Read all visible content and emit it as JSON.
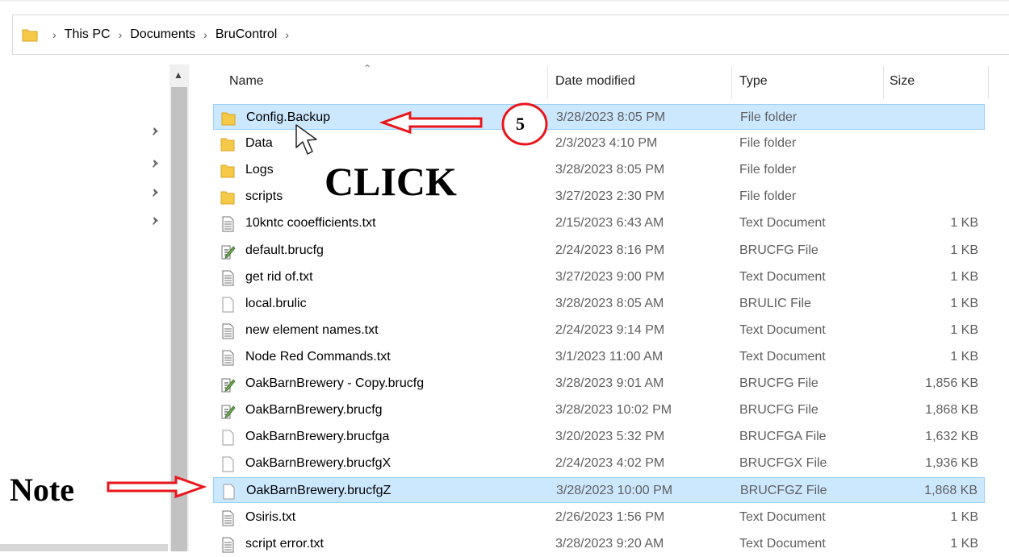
{
  "breadcrumb": [
    "This PC",
    "Documents",
    "BruControl"
  ],
  "columns": {
    "name": "Name",
    "date": "Date modified",
    "type": "Type",
    "size": "Size"
  },
  "files": [
    {
      "name": "Config.Backup",
      "date": "3/28/2023 8:05 PM",
      "type": "File folder",
      "size": "",
      "icon": "folder-icon"
    },
    {
      "name": "Data",
      "date": "2/3/2023 4:10 PM",
      "type": "File folder",
      "size": "",
      "icon": "folder-icon"
    },
    {
      "name": "Logs",
      "date": "3/28/2023 8:05 PM",
      "type": "File folder",
      "size": "",
      "icon": "folder-icon"
    },
    {
      "name": "scripts",
      "date": "3/27/2023 2:30 PM",
      "type": "File folder",
      "size": "",
      "icon": "folder-icon"
    },
    {
      "name": "10kntc cooefficients.txt",
      "date": "2/15/2023 6:43 AM",
      "type": "Text Document",
      "size": "1 KB",
      "icon": "text-file-icon"
    },
    {
      "name": "default.brucfg",
      "date": "2/24/2023 8:16 PM",
      "type": "BRUCFG File",
      "size": "1 KB",
      "icon": "config-file-icon"
    },
    {
      "name": "get rid of.txt",
      "date": "3/27/2023 9:00 PM",
      "type": "Text Document",
      "size": "1 KB",
      "icon": "text-file-icon"
    },
    {
      "name": "local.brulic",
      "date": "3/28/2023 8:05 AM",
      "type": "BRULIC File",
      "size": "1 KB",
      "icon": "blank-file-icon"
    },
    {
      "name": "new element names.txt",
      "date": "2/24/2023 9:14 PM",
      "type": "Text Document",
      "size": "1 KB",
      "icon": "text-file-icon"
    },
    {
      "name": "Node Red Commands.txt",
      "date": "3/1/2023 11:00 AM",
      "type": "Text Document",
      "size": "1 KB",
      "icon": "text-file-icon"
    },
    {
      "name": "OakBarnBrewery - Copy.brucfg",
      "date": "3/28/2023 9:01 AM",
      "type": "BRUCFG File",
      "size": "1,856 KB",
      "icon": "config-file-icon"
    },
    {
      "name": "OakBarnBrewery.brucfg",
      "date": "3/28/2023 10:02 PM",
      "type": "BRUCFG File",
      "size": "1,868 KB",
      "icon": "config-file-icon"
    },
    {
      "name": "OakBarnBrewery.brucfga",
      "date": "3/20/2023 5:32 PM",
      "type": "BRUCFGA File",
      "size": "1,632 KB",
      "icon": "blank-file-icon"
    },
    {
      "name": "OakBarnBrewery.brucfgX",
      "date": "2/24/2023 4:02 PM",
      "type": "BRUCFGX File",
      "size": "1,936 KB",
      "icon": "blank-file-icon"
    },
    {
      "name": "OakBarnBrewery.brucfgZ",
      "date": "3/28/2023 10:00 PM",
      "type": "BRUCFGZ File",
      "size": "1,868 KB",
      "icon": "blank-file-icon"
    },
    {
      "name": "Osiris.txt",
      "date": "2/26/2023 1:56 PM",
      "type": "Text Document",
      "size": "1 KB",
      "icon": "text-file-icon"
    },
    {
      "name": "script error.txt",
      "date": "3/28/2023 9:20 AM",
      "type": "Text Document",
      "size": "1 KB",
      "icon": "text-file-icon"
    }
  ],
  "annotations": {
    "click": "CLICK",
    "note": "Note",
    "step": "5"
  },
  "colors": {
    "selected_bg": "#cce8ff",
    "hover_bg": "#e5f3ff",
    "annotation_red": "#e8161b",
    "folder": "#f7c948"
  }
}
